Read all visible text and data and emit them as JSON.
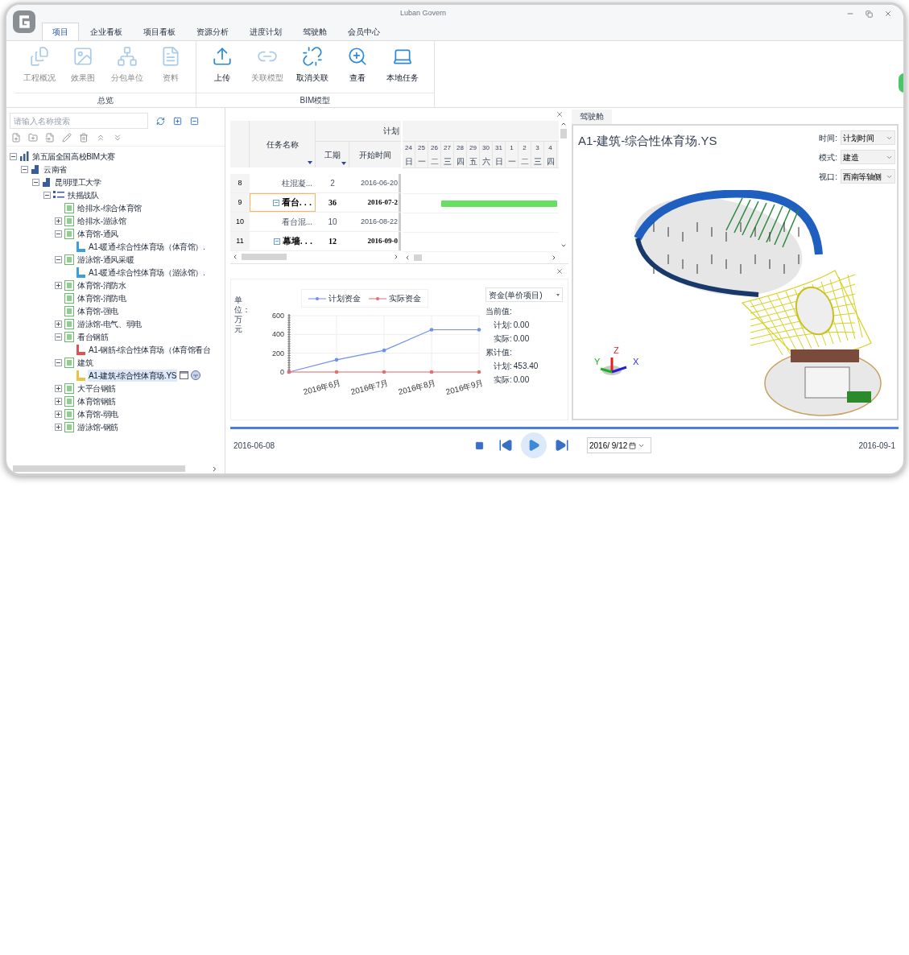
{
  "window": {
    "title": "Luban Govern"
  },
  "menu_tabs": [
    {
      "label": "项目",
      "selected": true
    },
    {
      "label": "企业看板",
      "selected": false
    },
    {
      "label": "项目看板",
      "selected": false
    },
    {
      "label": "资源分析",
      "selected": false
    },
    {
      "label": "进度计划",
      "selected": false
    },
    {
      "label": "驾驶舱",
      "selected": false
    },
    {
      "label": "会员中心",
      "selected": false
    }
  ],
  "ribbon": [
    {
      "label": "总览",
      "buttons": [
        {
          "label": "工程概况",
          "disabled": true
        },
        {
          "label": "效果图",
          "disabled": true
        },
        {
          "label": "分包单位",
          "disabled": true
        },
        {
          "label": "资料",
          "disabled": true
        }
      ]
    },
    {
      "label": "BIM模型",
      "buttons": [
        {
          "label": "上传",
          "disabled": false
        },
        {
          "label": "关联模型",
          "disabled": true
        },
        {
          "label": "取消关联",
          "disabled": false
        },
        {
          "label": "查看",
          "disabled": false
        },
        {
          "label": "本地任务",
          "disabled": false
        }
      ]
    }
  ],
  "tree_panel": {
    "search": {
      "placeholder": "请输入名称搜索"
    },
    "items": [
      {
        "label": "第五届全国高校BIM大赛",
        "kind": "project",
        "expanded": true,
        "selected": false,
        "children": [
          {
            "label": "云南省",
            "kind": "org",
            "expanded": true,
            "selected": false,
            "children": [
              {
                "label": "昆明理工大学",
                "kind": "org",
                "expanded": true,
                "selected": false,
                "children": [
                  {
                    "label": "扶摇战队",
                    "kind": "team",
                    "expanded": true,
                    "selected": false,
                    "children": [
                      {
                        "label": "给排水-综合体育馆",
                        "kind": "folder",
                        "selected": false
                      },
                      {
                        "label": "给排水-游泳馆",
                        "kind": "folder",
                        "expanded": false,
                        "selected": false
                      },
                      {
                        "label": "体育馆-通风",
                        "kind": "folder",
                        "expanded": true,
                        "selected": false,
                        "children": [
                          {
                            "label": "A1-暖通-综合性体育场（体育馆）.",
                            "kind": "model",
                            "color": "#3a9ee0",
                            "selected": false
                          }
                        ]
                      },
                      {
                        "label": "游泳馆-通风采暖",
                        "kind": "folder",
                        "expanded": true,
                        "selected": false,
                        "children": [
                          {
                            "label": "A1-暖通-综合性体育场（游泳馆）.",
                            "kind": "model",
                            "color": "#3a9ee0",
                            "selected": false
                          }
                        ]
                      },
                      {
                        "label": "体育馆-消防水",
                        "kind": "folder",
                        "expanded": false,
                        "selected": false
                      },
                      {
                        "label": "体育馆-消防电",
                        "kind": "folder",
                        "selected": false
                      },
                      {
                        "label": "体育馆-强电",
                        "kind": "folder",
                        "selected": false
                      },
                      {
                        "label": "游泳馆-电气、弱电",
                        "kind": "folder",
                        "expanded": false,
                        "selected": false
                      },
                      {
                        "label": "看台钢筋",
                        "kind": "folder",
                        "expanded": true,
                        "selected": false,
                        "children": [
                          {
                            "label": "A1-钢筋-综合性体育场（体育馆看台",
                            "kind": "model",
                            "color": "#e05050",
                            "selected": false
                          }
                        ]
                      },
                      {
                        "label": "建筑",
                        "kind": "folder",
                        "expanded": true,
                        "selected": false,
                        "children": [
                          {
                            "label": "A1-建筑-综合性体育场.YS",
                            "kind": "model",
                            "color": "#f0c040",
                            "selected": true
                          }
                        ]
                      },
                      {
                        "label": "大平台钢筋",
                        "kind": "folder",
                        "expanded": false,
                        "selected": false
                      },
                      {
                        "label": "体育馆钢筋",
                        "kind": "folder",
                        "expanded": false,
                        "selected": false
                      },
                      {
                        "label": "体育馆-弱电",
                        "kind": "folder",
                        "expanded": false,
                        "selected": false
                      },
                      {
                        "label": "游泳馆-钢筋",
                        "kind": "folder",
                        "expanded": false,
                        "selected": false
                      }
                    ]
                  }
                ]
              }
            ]
          }
        ]
      }
    ]
  },
  "gantt": {
    "columns": {
      "name": "任务名称",
      "plan": "计划",
      "duration": "工期",
      "start": "开始时间"
    },
    "days": [
      "24",
      "25",
      "26",
      "27",
      "28",
      "29",
      "30",
      "31",
      "1",
      "2",
      "3",
      "4"
    ],
    "weekdays": [
      "日",
      "一",
      "二",
      "三",
      "四",
      "五",
      "六",
      "日",
      "一",
      "二",
      "三",
      "四"
    ],
    "rows": [
      {
        "number": "8",
        "name": "柱混凝...",
        "duration": "2",
        "start": "2016-06-20",
        "kind": "task",
        "selected": false,
        "bar": false
      },
      {
        "number": "9",
        "name": "看台. . .",
        "duration": "36",
        "start": "2016-07-2",
        "kind": "group",
        "expanded": true,
        "selected": true,
        "bar": true
      },
      {
        "number": "10",
        "name": "看台混...",
        "duration": "10",
        "start": "2016-08-22",
        "kind": "task",
        "selected": false,
        "bar": false
      },
      {
        "number": "11",
        "name": "幕墙. . .",
        "duration": "12",
        "start": "2016-09-0",
        "kind": "group",
        "expanded": true,
        "selected": false,
        "bar": false
      }
    ]
  },
  "funds": {
    "chart_data": {
      "type": "line",
      "ylabel": "单位：万元",
      "categories": [
        null,
        "2016年6月",
        "2016年7月",
        "2016年8月",
        "2016年9月"
      ],
      "legend": "top",
      "ylim": [
        0,
        600
      ],
      "yticks": [
        0,
        200,
        400,
        600
      ],
      "series": [
        {
          "name": "计划资金",
          "color": "#6f8ff0",
          "values": [
            0,
            130,
            230,
            450,
            450
          ]
        },
        {
          "name": "实际资金",
          "color": "#e07070",
          "values": [
            0,
            0,
            0,
            0,
            0
          ]
        }
      ]
    },
    "dropdown": "资金(单价项目)",
    "current_label": "当前值:",
    "current": [
      {
        "label": "计划:",
        "value": "0.00"
      },
      {
        "label": "实际:",
        "value": "0.00"
      }
    ],
    "total_label": "累计值:",
    "total": [
      {
        "label": "计划:",
        "value": "453.40"
      },
      {
        "label": "实际:",
        "value": "0.00"
      }
    ]
  },
  "viewer": {
    "tab": "驾驶舱",
    "model_title": "A1-建筑-综合性体育场.YS",
    "controls": [
      {
        "label": "时间:",
        "value": "计划时间"
      },
      {
        "label": "模式:",
        "value": "建造"
      },
      {
        "label": "视口:",
        "value": "西南等轴侧"
      }
    ],
    "axes": [
      "Y",
      "Z",
      "X"
    ]
  },
  "playback": {
    "level": 1.0,
    "start_date": "2016-06-08",
    "date_picker": "2016/ 9/12",
    "end_date": "2016-09-1"
  }
}
